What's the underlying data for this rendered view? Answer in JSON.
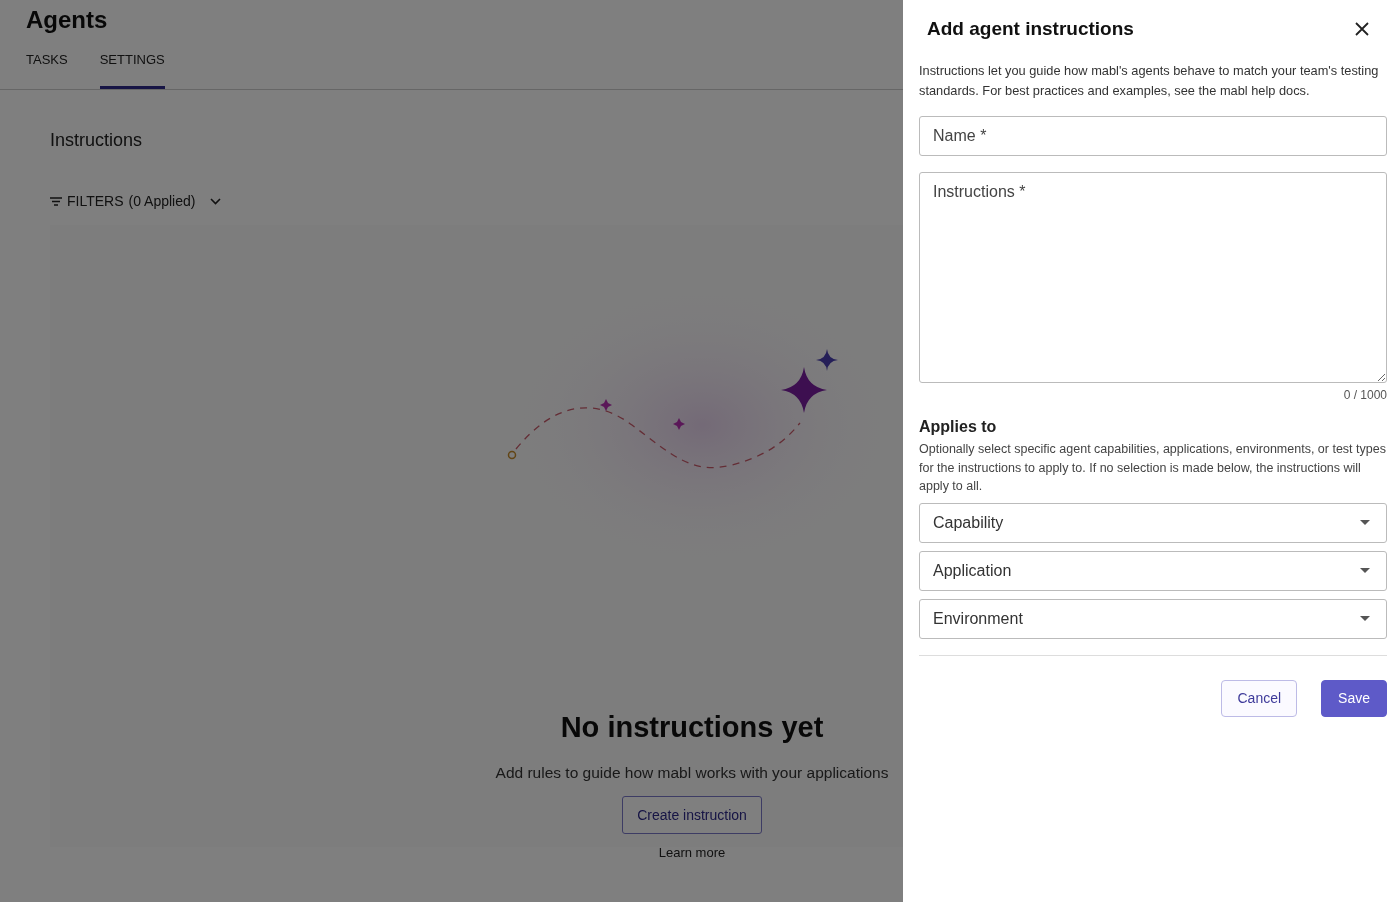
{
  "page": {
    "title": "Agents",
    "tabs": [
      {
        "label": "TASKS",
        "selected": false
      },
      {
        "label": "SETTINGS",
        "selected": true
      }
    ],
    "section_title": "Instructions",
    "filters": {
      "label": "FILTERS",
      "applied": "(0 Applied)"
    },
    "empty_state": {
      "title": "No instructions yet",
      "text": "Add rules to guide how mabl works with your applications",
      "button": "Create instruction",
      "link": "Learn more"
    }
  },
  "drawer": {
    "title": "Add agent instructions",
    "intro": "Instructions let you guide how mabl's agents behave to match your team's testing standards. For best practices and examples, see the mabl help docs.",
    "name_field": {
      "placeholder": "Name *"
    },
    "instructions_field": {
      "placeholder": "Instructions *",
      "counter": "0 / 1000"
    },
    "applies_to": {
      "heading": "Applies to",
      "text": "Optionally select specific agent capabilities, applications, environments, or test types for the instructions to apply to. If no selection is made below, the instructions will apply to all."
    },
    "selects": [
      {
        "placeholder": "Capability"
      },
      {
        "placeholder": "Application"
      },
      {
        "placeholder": "Environment"
      }
    ],
    "buttons": [
      {
        "label": "Cancel",
        "kind": "secondary"
      },
      {
        "label": "Save",
        "kind": "primary"
      }
    ]
  }
}
